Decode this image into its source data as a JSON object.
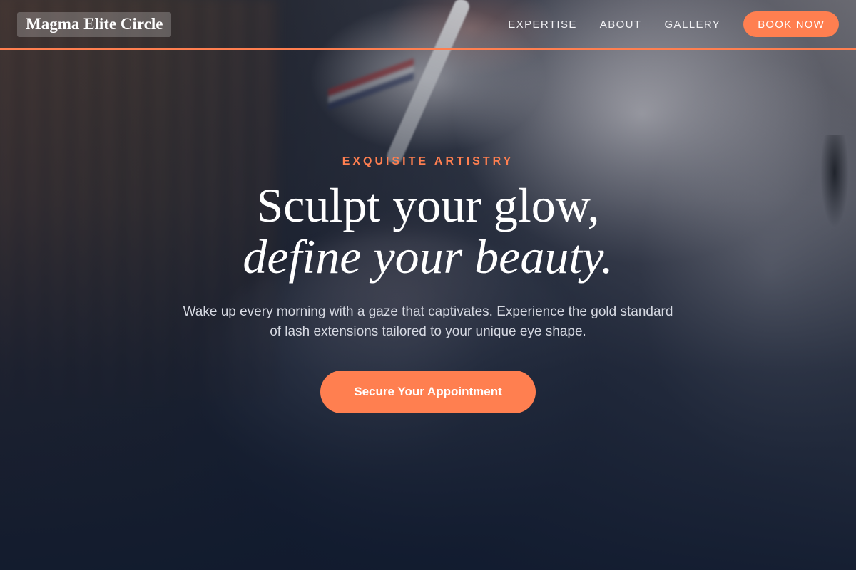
{
  "brand": {
    "logo_text": "Magma Elite Circle",
    "accent_color": "#ff7f50",
    "background_color": "#101a2e"
  },
  "nav": {
    "links": [
      {
        "label": "EXPERTISE"
      },
      {
        "label": "ABOUT"
      },
      {
        "label": "GALLERY"
      }
    ],
    "cta_label": "BOOK NOW"
  },
  "hero": {
    "eyebrow": "EXQUISITE ARTISTRY",
    "headline_line1": "Sculpt your glow,",
    "headline_line2": "define your beauty.",
    "subtext": "Wake up every morning with a gaze that captivates. Experience the gold standard of lash extensions tailored to your unique eye shape.",
    "cta_label": "Secure Your Appointment"
  }
}
